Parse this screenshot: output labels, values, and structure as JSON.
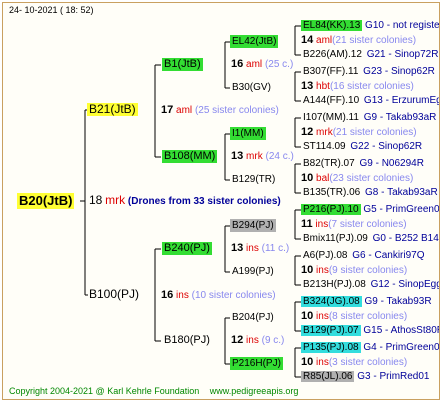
{
  "header": {
    "timestamp": "24- 10-2021 ( 18: 52)"
  },
  "root": {
    "label": "B20(JtB)",
    "number": "18",
    "code": "mrk",
    "note": "(Drones from 33 sister colonies)"
  },
  "g1": [
    {
      "label": "B21(JtB)",
      "number": "17",
      "code": "aml",
      "note": "(25 sister colonies)"
    },
    {
      "label": "B100(PJ)",
      "number": "16",
      "code": "ins",
      "note": "(10 sister colonies)"
    }
  ],
  "g2": [
    {
      "label": "B1(JtB)",
      "number": "16",
      "code": "aml",
      "note": "(25 c.)"
    },
    {
      "label": "B108(MM)",
      "number": "13",
      "code": "mrk",
      "note": "(24 c.)"
    },
    {
      "label": "B240(PJ)",
      "number": "13",
      "code": "ins",
      "note": "(11 c.)"
    },
    {
      "label": "B180(PJ)",
      "number": "12",
      "code": "ins",
      "note": "(9 c.)"
    }
  ],
  "g3": [
    {
      "label": "EL42(JtB)"
    },
    {
      "label": "B30(GV)"
    },
    {
      "label": "I1(MM)"
    },
    {
      "label": "B129(TR)"
    },
    {
      "label": "B294(PJ)"
    },
    {
      "label": "A199(PJ)"
    },
    {
      "label": "B204(PJ)"
    },
    {
      "label": "P216H(PJ)"
    }
  ],
  "g4": [
    {
      "label": "EL84(KK).13",
      "link": "G10 - not registe"
    },
    {
      "number": "14",
      "code": "aml",
      "note": "(21 sister colonies)"
    },
    {
      "label": "B226(AM).12",
      "link": "G21 - Sinop72R"
    },
    {
      "label": "B307(FF).11",
      "link": "G23 - Sinop62R"
    },
    {
      "number": "13",
      "code": "hbt",
      "note": "(16 sister colonies)"
    },
    {
      "label": "A144(FF).10",
      "link": "G13 - ErzurumEgg8"
    },
    {
      "label": "I107(MM).11",
      "link": "G9 - Takab93aR"
    },
    {
      "number": "12",
      "code": "mrk",
      "note": "(21 sister colonies)"
    },
    {
      "label": "ST114.09",
      "link": "G22 - Sinop62R"
    },
    {
      "label": "B82(TR).07",
      "link": "G9 - N06294R"
    },
    {
      "number": "10",
      "code": "bal",
      "note": "(23 sister colonies)"
    },
    {
      "label": "B135(TR).06",
      "link": "G8 - Takab93aR"
    },
    {
      "label": "P216(PJ).10",
      "link": "G5 - PrimGreen00"
    },
    {
      "number": "11",
      "code": "ins",
      "note": "(7 sister colonies)"
    },
    {
      "label": "Bmix11(PJ).09",
      "link": "G0 - B252 B147 B"
    },
    {
      "label": "A6(PJ).08",
      "link": "G6 - Cankiri97Q"
    },
    {
      "number": "10",
      "code": "ins",
      "note": "(9 sister colonies)"
    },
    {
      "label": "B213H(PJ).08",
      "link": "G12 - SinopEgg86R"
    },
    {
      "label": "B324(JG).08",
      "link": "G9 - Takab93R"
    },
    {
      "number": "10",
      "code": "ins",
      "note": "(8 sister colonies)"
    },
    {
      "label": "B129(PJ).07",
      "link": "G15 - AthosSt80R"
    },
    {
      "label": "P135(PJ).08",
      "link": "G4 - PrimGreen00"
    },
    {
      "number": "10",
      "code": "ins",
      "note": "(3 sister colonies)"
    },
    {
      "label": "R85(JL).06",
      "link": "G3 - PrimRed01"
    }
  ],
  "footer": {
    "copyright": "Copyright 2004-2021 @ Karl Kehrle Foundation",
    "url": "www.pedigreeapis.org"
  }
}
